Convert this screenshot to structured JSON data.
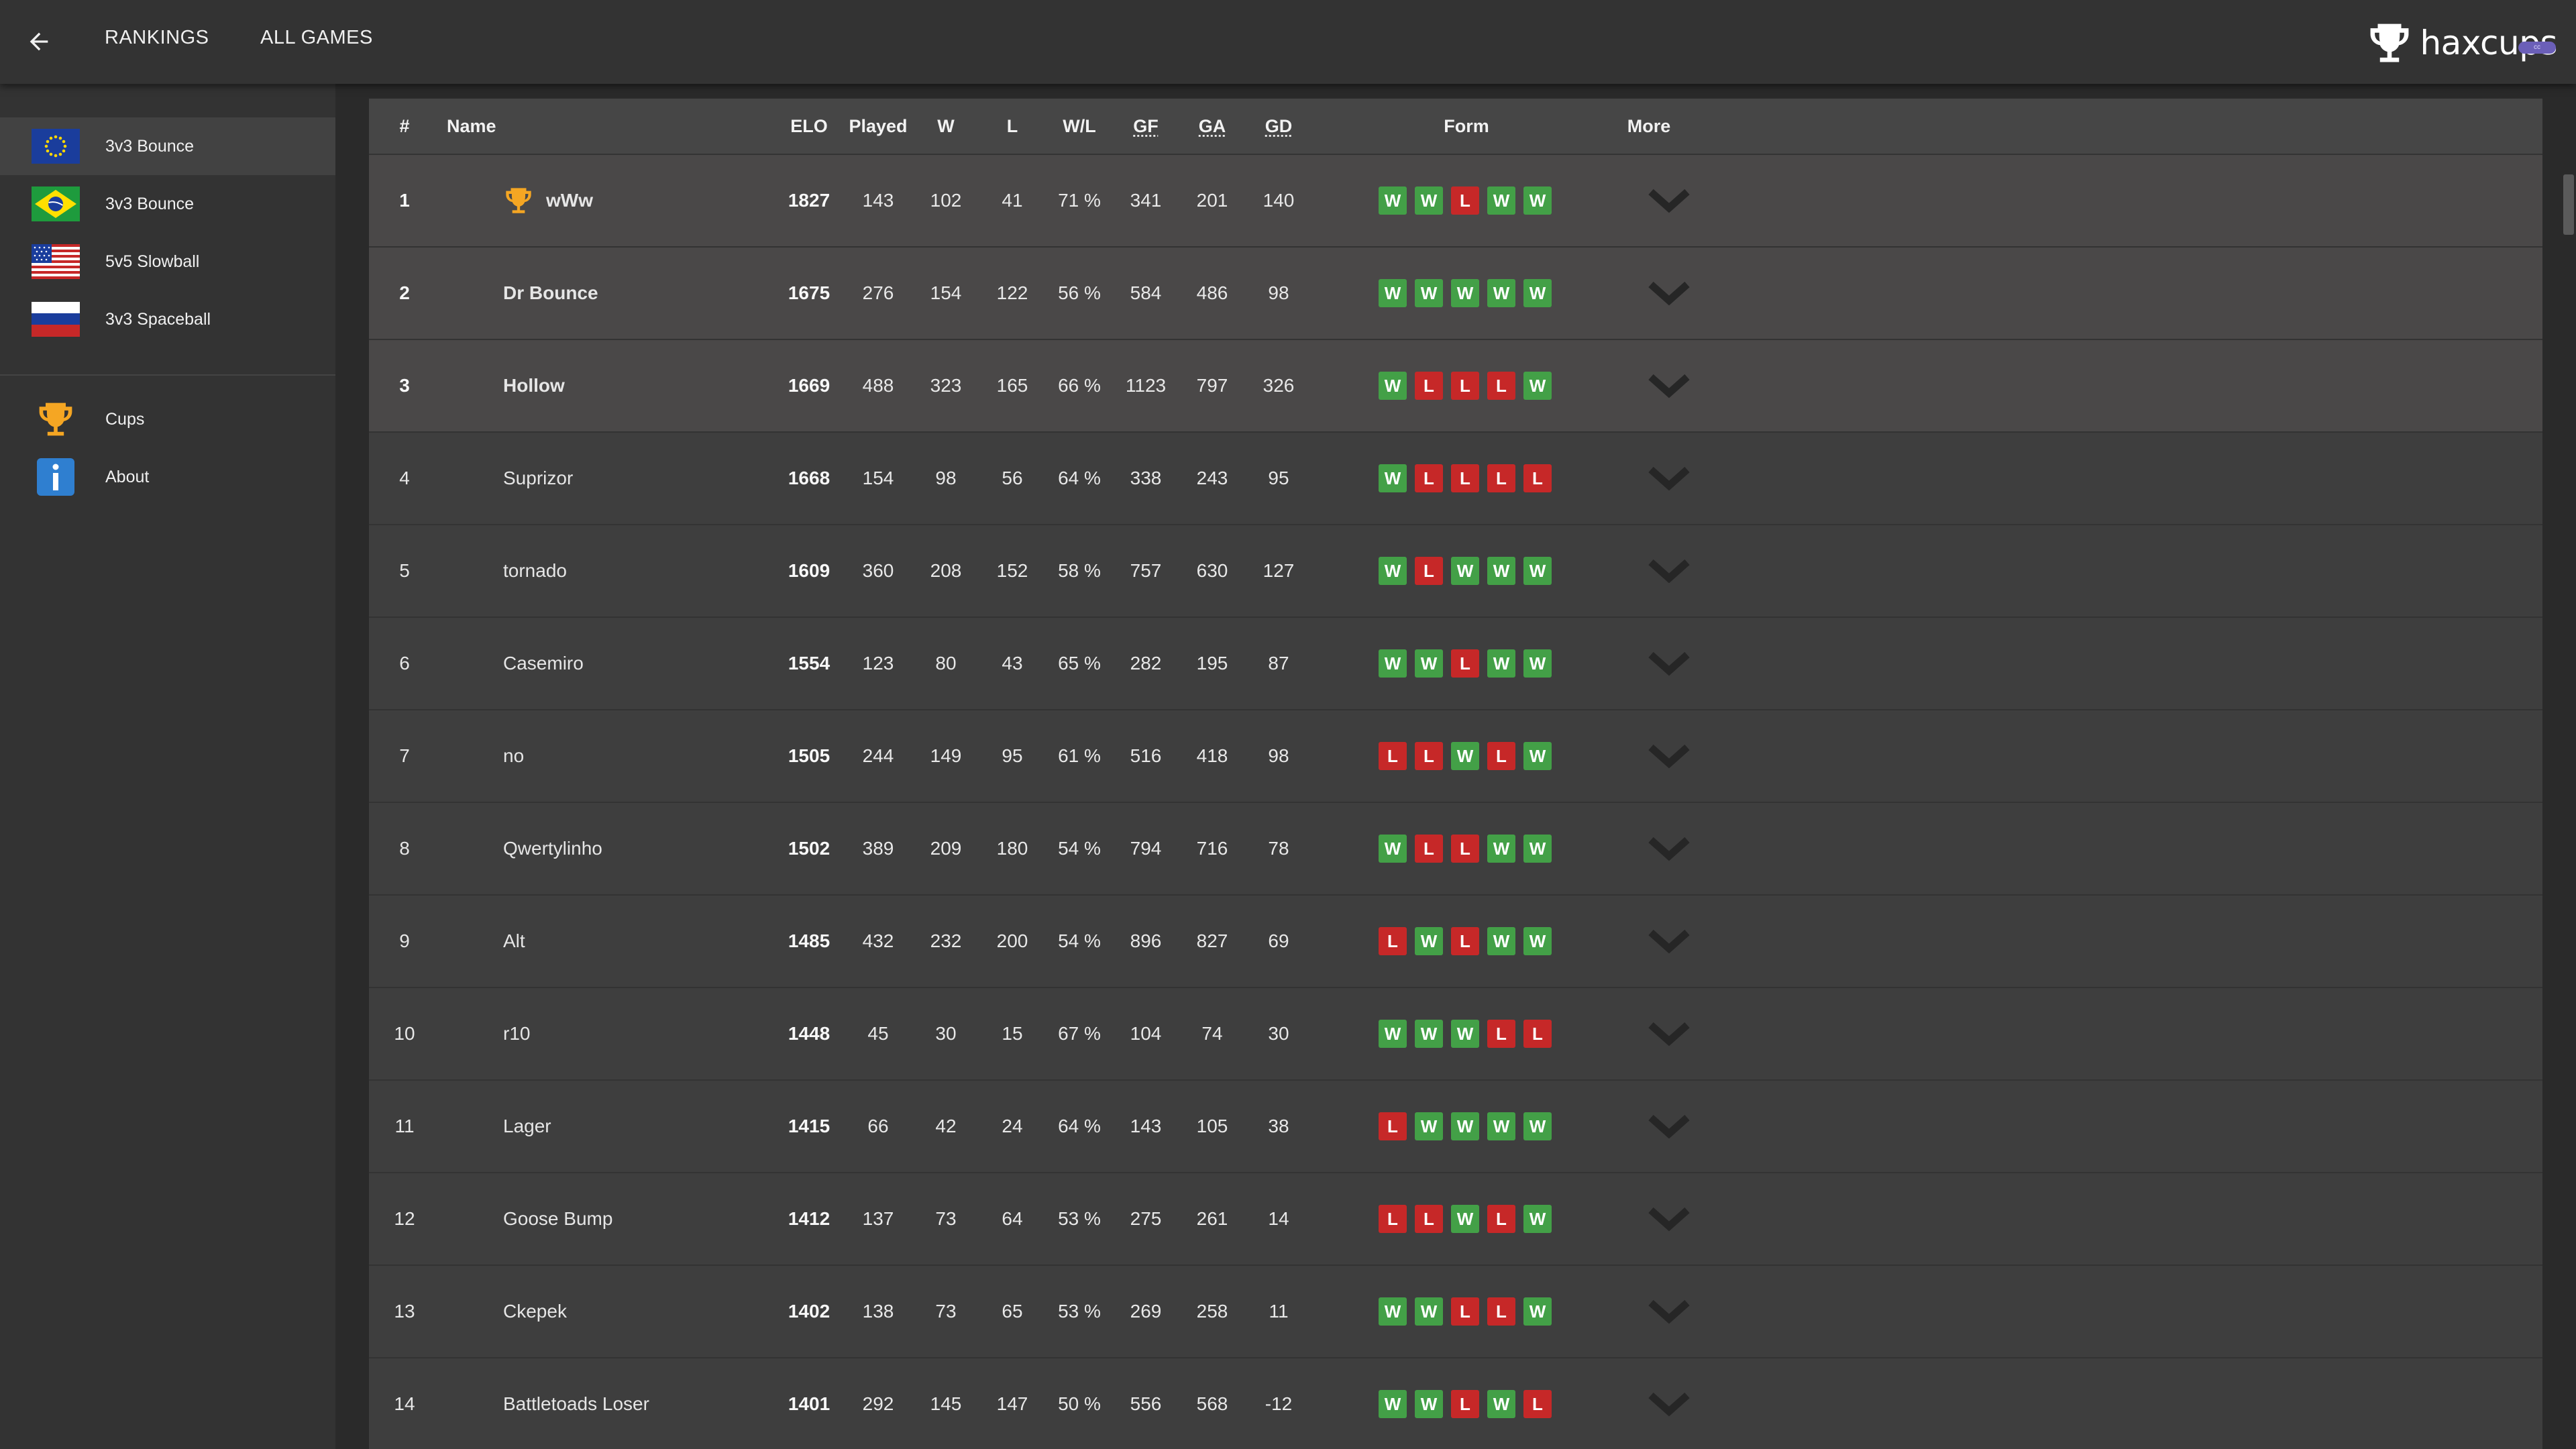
{
  "header": {
    "back_label": "",
    "tabs": [
      {
        "label": "RANKINGS"
      },
      {
        "label": "ALL GAMES"
      }
    ],
    "logo_text": "haxcups",
    "logo_badge": "cc"
  },
  "sidebar": {
    "leagues": [
      {
        "label": "3v3 Bounce",
        "flag": "eu-flag-icon"
      },
      {
        "label": "3v3 Bounce",
        "flag": "brazil-flag-icon"
      },
      {
        "label": "5v5 Slowball",
        "flag": "usa-flag-icon"
      },
      {
        "label": "3v3 Spaceball",
        "flag": "russia-flag-icon"
      }
    ],
    "links": [
      {
        "label": "Cups",
        "icon": "trophy-icon"
      },
      {
        "label": "About",
        "icon": "info-icon"
      }
    ]
  },
  "table": {
    "headers": {
      "rank": "#",
      "name": "Name",
      "elo": "ELO",
      "played": "Played",
      "w": "W",
      "l": "L",
      "wl": "W/L",
      "gf": "GF",
      "ga": "GA",
      "gd": "GD",
      "form": "Form",
      "more": "More"
    },
    "rows": [
      {
        "rank": "1",
        "name": "wWw",
        "champion": true,
        "elo": "1827",
        "played": "143",
        "w": "102",
        "l": "41",
        "wl": "71 %",
        "gf": "341",
        "ga": "201",
        "gd": "140",
        "form": [
          "W",
          "W",
          "L",
          "W",
          "W"
        ]
      },
      {
        "rank": "2",
        "name": "Dr Bounce",
        "elo": "1675",
        "played": "276",
        "w": "154",
        "l": "122",
        "wl": "56 %",
        "gf": "584",
        "ga": "486",
        "gd": "98",
        "form": [
          "W",
          "W",
          "W",
          "W",
          "W"
        ]
      },
      {
        "rank": "3",
        "name": "Hollow",
        "elo": "1669",
        "played": "488",
        "w": "323",
        "l": "165",
        "wl": "66 %",
        "gf": "1123",
        "ga": "797",
        "gd": "326",
        "form": [
          "W",
          "L",
          "L",
          "L",
          "W"
        ]
      },
      {
        "rank": "4",
        "name": "Suprizor",
        "elo": "1668",
        "played": "154",
        "w": "98",
        "l": "56",
        "wl": "64 %",
        "gf": "338",
        "ga": "243",
        "gd": "95",
        "form": [
          "W",
          "L",
          "L",
          "L",
          "L"
        ]
      },
      {
        "rank": "5",
        "name": "tornado",
        "elo": "1609",
        "played": "360",
        "w": "208",
        "l": "152",
        "wl": "58 %",
        "gf": "757",
        "ga": "630",
        "gd": "127",
        "form": [
          "W",
          "L",
          "W",
          "W",
          "W"
        ]
      },
      {
        "rank": "6",
        "name": "Casemiro",
        "elo": "1554",
        "played": "123",
        "w": "80",
        "l": "43",
        "wl": "65 %",
        "gf": "282",
        "ga": "195",
        "gd": "87",
        "form": [
          "W",
          "W",
          "L",
          "W",
          "W"
        ]
      },
      {
        "rank": "7",
        "name": "no",
        "elo": "1505",
        "played": "244",
        "w": "149",
        "l": "95",
        "wl": "61 %",
        "gf": "516",
        "ga": "418",
        "gd": "98",
        "form": [
          "L",
          "L",
          "W",
          "L",
          "W"
        ]
      },
      {
        "rank": "8",
        "name": "Qwertylinho",
        "elo": "1502",
        "played": "389",
        "w": "209",
        "l": "180",
        "wl": "54 %",
        "gf": "794",
        "ga": "716",
        "gd": "78",
        "form": [
          "W",
          "L",
          "L",
          "W",
          "W"
        ]
      },
      {
        "rank": "9",
        "name": "Alt",
        "elo": "1485",
        "played": "432",
        "w": "232",
        "l": "200",
        "wl": "54 %",
        "gf": "896",
        "ga": "827",
        "gd": "69",
        "form": [
          "L",
          "W",
          "L",
          "W",
          "W"
        ]
      },
      {
        "rank": "10",
        "name": "r10",
        "elo": "1448",
        "played": "45",
        "w": "30",
        "l": "15",
        "wl": "67 %",
        "gf": "104",
        "ga": "74",
        "gd": "30",
        "form": [
          "W",
          "W",
          "W",
          "L",
          "L"
        ]
      },
      {
        "rank": "11",
        "name": "Lager",
        "elo": "1415",
        "played": "66",
        "w": "42",
        "l": "24",
        "wl": "64 %",
        "gf": "143",
        "ga": "105",
        "gd": "38",
        "form": [
          "L",
          "W",
          "W",
          "W",
          "W"
        ]
      },
      {
        "rank": "12",
        "name": "Goose Bump",
        "elo": "1412",
        "played": "137",
        "w": "73",
        "l": "64",
        "wl": "53 %",
        "gf": "275",
        "ga": "261",
        "gd": "14",
        "form": [
          "L",
          "L",
          "W",
          "L",
          "W"
        ]
      },
      {
        "rank": "13",
        "name": "Ckepek",
        "elo": "1402",
        "played": "138",
        "w": "73",
        "l": "65",
        "wl": "53 %",
        "gf": "269",
        "ga": "258",
        "gd": "11",
        "form": [
          "W",
          "W",
          "L",
          "L",
          "W"
        ]
      },
      {
        "rank": "14",
        "name": "Battletoads Loser",
        "elo": "1401",
        "played": "292",
        "w": "145",
        "l": "147",
        "wl": "50 %",
        "gf": "556",
        "ga": "568",
        "gd": "-12",
        "form": [
          "W",
          "W",
          "L",
          "W",
          "L"
        ]
      }
    ]
  },
  "colors": {
    "win": "#43a047",
    "loss": "#c62828",
    "accent": "#6b5fb8"
  }
}
